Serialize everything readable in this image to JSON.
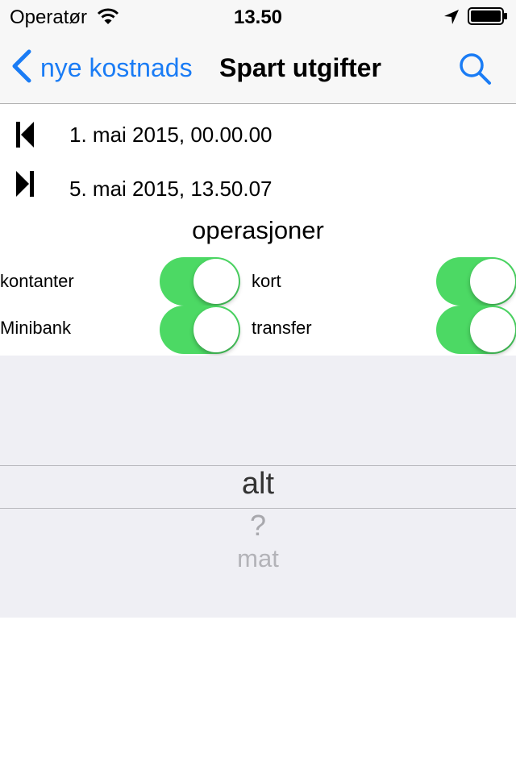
{
  "status_bar": {
    "carrier": "Operatør",
    "time": "13.50"
  },
  "nav": {
    "back_label": "nye kostnads",
    "title": "Spart utgifter",
    "accent_color": "#1a7cf5"
  },
  "date_range": {
    "start": "1. mai 2015, 00.00.00",
    "end": "5. mai 2015, 13.50.07"
  },
  "operations": {
    "heading": "operasjoner",
    "toggle_color": "#4cd964",
    "options": [
      {
        "label": "kontanter",
        "on": true
      },
      {
        "label": "kort",
        "on": true
      },
      {
        "label": "Minibank",
        "on": true
      },
      {
        "label": "transfer",
        "on": true
      }
    ]
  },
  "picker": {
    "selected": "alt",
    "items": [
      "?",
      "mat"
    ]
  }
}
